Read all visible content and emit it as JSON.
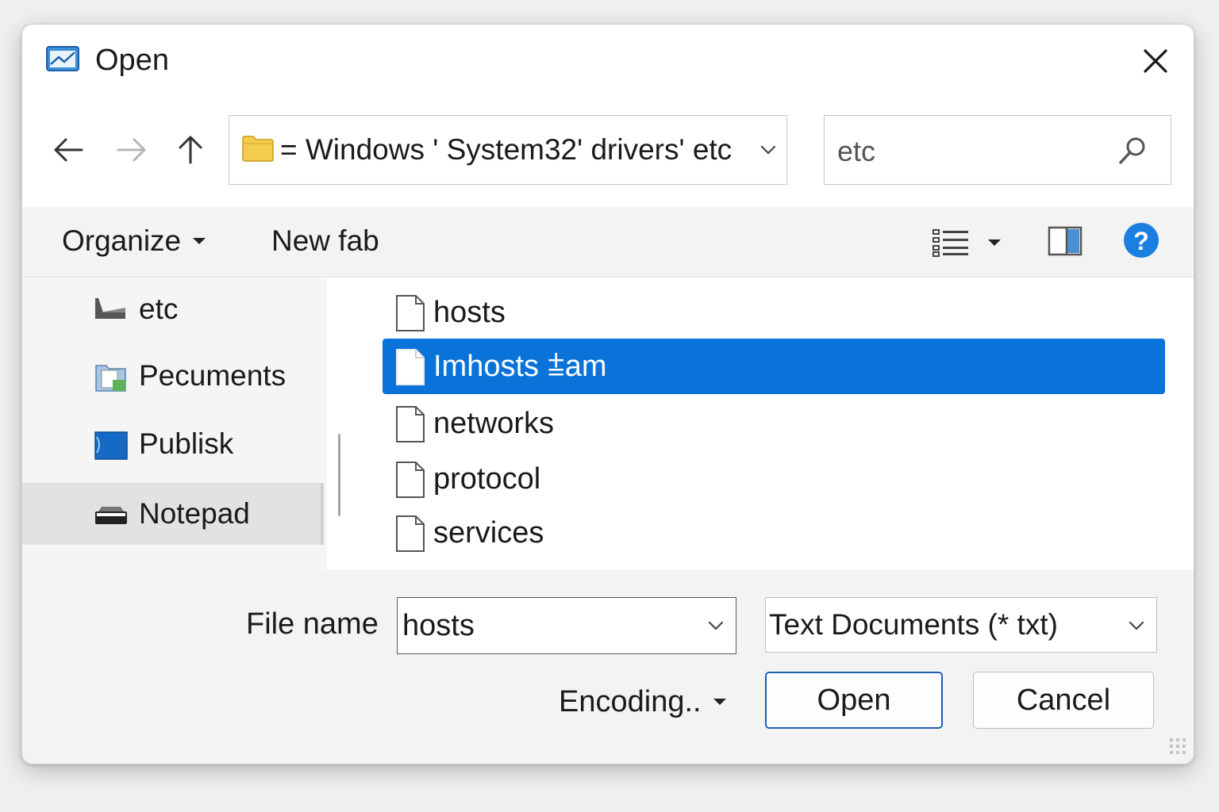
{
  "window": {
    "title": "Open"
  },
  "address": {
    "path": "= Windows ' System32' drivers' etc"
  },
  "search": {
    "value": "etc"
  },
  "toolbar": {
    "organize": "Organize",
    "new_folder": "New fab"
  },
  "nav_items": [
    {
      "label": "etc",
      "icon": "drive-icon"
    },
    {
      "label": "Pecuments",
      "icon": "documents-folder-icon"
    },
    {
      "label": "Publisk",
      "icon": "blue-folder-icon"
    },
    {
      "label": "Notepad",
      "icon": "drive-icon",
      "selected": true
    }
  ],
  "files": [
    {
      "name": "hosts",
      "selected": false
    },
    {
      "name": "Imhosts ⩲am",
      "selected": true
    },
    {
      "name": "networks",
      "selected": false
    },
    {
      "name": "protocol",
      "selected": false
    },
    {
      "name": "services",
      "selected": false
    }
  ],
  "footer": {
    "file_name_label": "File name",
    "file_name_value": "hosts",
    "file_type": "Text Documents (* txt)",
    "encoding_label": "Encoding..",
    "open_label": "Open",
    "cancel_label": "Cancel"
  },
  "colors": {
    "accent": "#0a73d9",
    "help": "#1a7fe0",
    "open_border": "#1f5fb2"
  }
}
